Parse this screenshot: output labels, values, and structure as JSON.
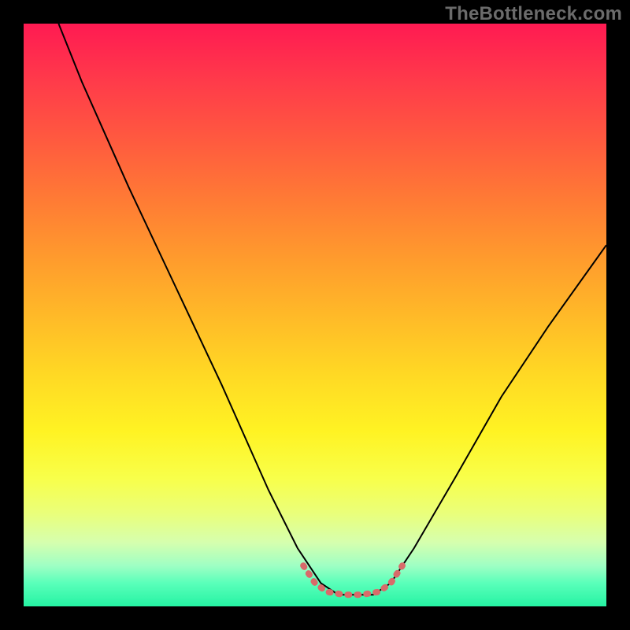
{
  "watermark": "TheBottleneck.com",
  "chart_data": {
    "type": "line",
    "title": "",
    "xlabel": "",
    "ylabel": "",
    "xlim": [
      0,
      100
    ],
    "ylim": [
      0,
      100
    ],
    "series": [
      {
        "name": "black-curve",
        "color": "#000000",
        "width": 2,
        "points": [
          {
            "x": 6,
            "y": 100
          },
          {
            "x": 10,
            "y": 90
          },
          {
            "x": 18,
            "y": 72
          },
          {
            "x": 26,
            "y": 55
          },
          {
            "x": 34,
            "y": 38
          },
          {
            "x": 42,
            "y": 20
          },
          {
            "x": 47,
            "y": 10
          },
          {
            "x": 51,
            "y": 4
          },
          {
            "x": 54,
            "y": 2
          },
          {
            "x": 60,
            "y": 2
          },
          {
            "x": 63,
            "y": 4
          },
          {
            "x": 67,
            "y": 10
          },
          {
            "x": 74,
            "y": 22
          },
          {
            "x": 82,
            "y": 36
          },
          {
            "x": 90,
            "y": 48
          },
          {
            "x": 100,
            "y": 62
          }
        ]
      },
      {
        "name": "valley-highlight",
        "color": "#d86a6a",
        "width": 8,
        "points": [
          {
            "x": 48,
            "y": 7
          },
          {
            "x": 50,
            "y": 4
          },
          {
            "x": 52,
            "y": 2.5
          },
          {
            "x": 55,
            "y": 2
          },
          {
            "x": 58,
            "y": 2
          },
          {
            "x": 61,
            "y": 2.5
          },
          {
            "x": 63,
            "y": 4
          },
          {
            "x": 65,
            "y": 7
          }
        ]
      }
    ],
    "background_gradient": {
      "top": "#ff1a52",
      "mid": "#ffd824",
      "bottom": "#25f3a3"
    }
  }
}
